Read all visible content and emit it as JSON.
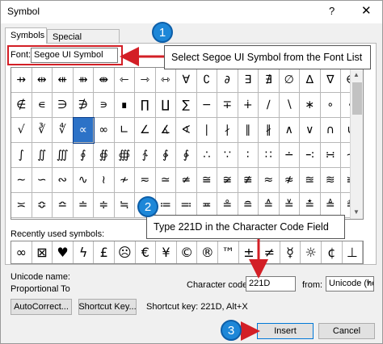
{
  "window": {
    "title": "Symbol",
    "help_label": "?",
    "close_label": "✕"
  },
  "tabs": [
    {
      "label": "Symbols"
    },
    {
      "label": "Special Characters"
    }
  ],
  "font": {
    "label": "Font:",
    "value": "Segoe UI Symbol"
  },
  "symbol_grid": {
    "rows": [
      [
        "⇸",
        "⇹",
        "⇺",
        "⇻",
        "⇼",
        "⇽",
        "⇾",
        "⇿",
        "∀",
        "∁",
        "∂",
        "∃",
        "∄",
        "∅",
        "∆",
        "∇",
        "∈"
      ],
      [
        "∉",
        "∊",
        "∋",
        "∌",
        "∍",
        "∎",
        "∏",
        "∐",
        "∑",
        "−",
        "∓",
        "∔",
        "∕",
        "∖",
        "∗",
        "∘",
        "∙"
      ],
      [
        "√",
        "∛",
        "∜",
        "∝",
        "∞",
        "∟",
        "∠",
        "∡",
        "∢",
        "∣",
        "∤",
        "∥",
        "∦",
        "∧",
        "∨",
        "∩",
        "∪"
      ],
      [
        "∫",
        "∬",
        "∭",
        "∮",
        "∯",
        "∰",
        "∱",
        "∲",
        "∳",
        "∴",
        "∵",
        "∶",
        "∷",
        "∸",
        "∹",
        "∺",
        "∻"
      ],
      [
        "∼",
        "∽",
        "∾",
        "∿",
        "≀",
        "≁",
        "≂",
        "≃",
        "≄",
        "≅",
        "≆",
        "≇",
        "≈",
        "≉",
        "≊",
        "≋",
        "≌"
      ],
      [
        "≍",
        "≎",
        "≏",
        "≐",
        "≑",
        "≒",
        "≓",
        "≔",
        "≕",
        "≖",
        "≗",
        "≘",
        "≙",
        "≚",
        "≛",
        "≜",
        "≝"
      ]
    ],
    "selected": "∝"
  },
  "recent": {
    "label": "Recently used symbols:",
    "symbols": [
      "∞",
      "⊠",
      "♥",
      "ϟ",
      "£",
      "☹",
      "€",
      "¥",
      "©",
      "®",
      "™",
      "±",
      "≠",
      "☿",
      "☼",
      "¢",
      "⊥"
    ]
  },
  "unicode_name": {
    "label": "Unicode name:",
    "value": "Proportional To"
  },
  "character_code": {
    "label": "Character code:",
    "value": "221D"
  },
  "from": {
    "label": "from:",
    "value": "Unicode (hex)"
  },
  "buttons": {
    "autocorrect": "AutoCorrect...",
    "shortcut_key": "Shortcut Key...",
    "insert": "Insert",
    "cancel": "Cancel"
  },
  "shortcut_key_text": "Shortcut key: 221D, Alt+X",
  "callouts": [
    {
      "number": "1",
      "text": "Select Segoe UI Symbol from the Font List"
    },
    {
      "number": "2",
      "text": "Type 221D in the Character Code Field"
    },
    {
      "number": "3"
    }
  ],
  "colors": {
    "accent_blue": "#1d87d8",
    "arrow_red": "#d31f26",
    "selection": "#2c72c7"
  }
}
